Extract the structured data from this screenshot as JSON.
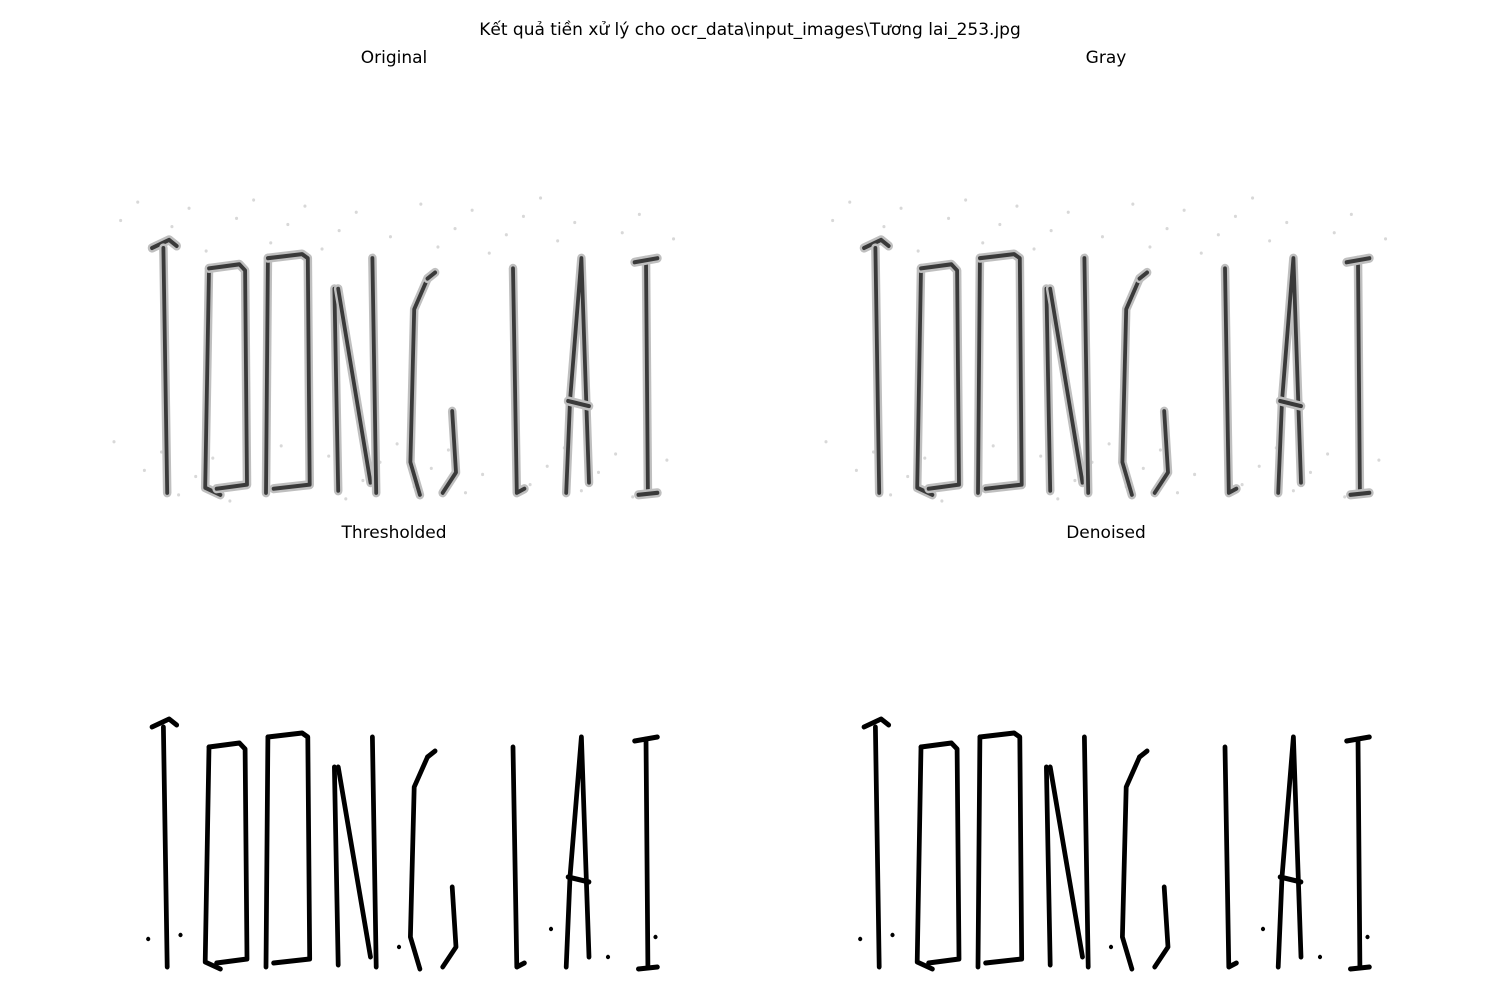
{
  "figure": {
    "suptitle": "Kết quả tiền xử lý cho ocr_data\\input_images\\Tương lai_253.jpg",
    "panels": [
      {
        "title": "Original",
        "style": "soft-gray"
      },
      {
        "title": "Gray",
        "style": "soft-gray"
      },
      {
        "title": "Thresholded",
        "style": "binary"
      },
      {
        "title": "Denoised",
        "style": "binary"
      }
    ],
    "image_content_text": "TƯƠNG LAI"
  },
  "colors": {
    "background": "#ffffff",
    "ink": "#000000",
    "gray_ink": "#3a3a3a",
    "noise": "#d8d8d8"
  },
  "icons": {
    "word_image": "word-image-icon"
  }
}
